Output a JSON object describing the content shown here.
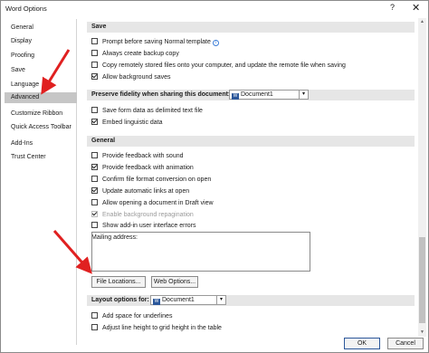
{
  "window": {
    "title": "Word Options",
    "help_glyph": "?",
    "close_glyph": "✕"
  },
  "sidebar": {
    "items": [
      {
        "label": "General"
      },
      {
        "label": "Display"
      },
      {
        "label": "Proofing"
      },
      {
        "label": "Save"
      },
      {
        "label": "Language"
      },
      {
        "label": "Advanced",
        "active": true
      },
      {
        "label": "Customize Ribbon"
      },
      {
        "label": "Quick Access Toolbar"
      },
      {
        "label": "Add-Ins"
      },
      {
        "label": "Trust Center"
      }
    ]
  },
  "save_section": {
    "header": "Save",
    "options": [
      {
        "label": "Prompt before saving Normal template",
        "checked": false
      },
      {
        "label": "Always create backup copy",
        "checked": false
      },
      {
        "label": "Copy remotely stored files onto your computer, and update the remote file when saving",
        "checked": false
      },
      {
        "label": "Allow background saves",
        "checked": true
      }
    ]
  },
  "fidelity_section": {
    "header": "Preserve fidelity when sharing this document:",
    "document": "Document1",
    "options": [
      {
        "label": "Save form data as delimited text file",
        "checked": false
      },
      {
        "label": "Embed linguistic data",
        "checked": true
      }
    ]
  },
  "general_section": {
    "header": "General",
    "options": [
      {
        "label": "Provide feedback with sound",
        "checked": false
      },
      {
        "label": "Provide feedback with animation",
        "checked": true
      },
      {
        "label": "Confirm file format conversion on open",
        "checked": false
      },
      {
        "label": "Update automatic links at open",
        "checked": true
      },
      {
        "label": "Allow opening a document in Draft view",
        "checked": false
      },
      {
        "label": "Enable background repagination",
        "checked": true,
        "disabled": true
      },
      {
        "label": "Show add-in user interface errors",
        "checked": false
      }
    ],
    "mailing_label": "Mailing address:",
    "mailing_value": "",
    "file_locations_button": "File Locations...",
    "web_options_button": "Web Options..."
  },
  "layout_section": {
    "header": "Layout options for:",
    "document": "Document1",
    "options": [
      {
        "label": "Add space for underlines",
        "checked": false
      },
      {
        "label": "Adjust line height to grid height in the table",
        "checked": false
      }
    ]
  },
  "footer": {
    "ok": "OK",
    "cancel": "Cancel"
  },
  "colors": {
    "annotation_arrow": "#e02020",
    "active_nav": "#c6c6c6",
    "section_header": "#e6e6e6"
  }
}
